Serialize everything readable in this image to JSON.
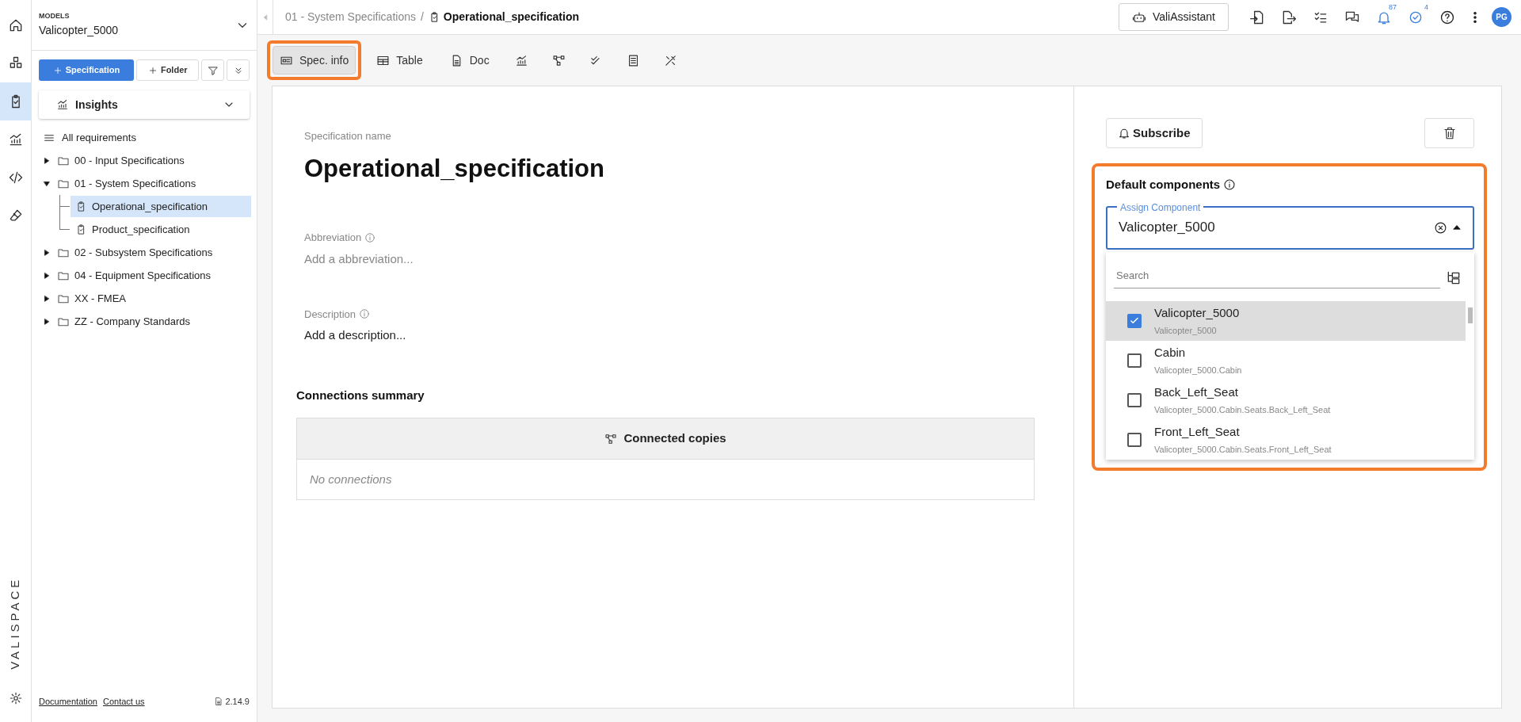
{
  "rail": {
    "items": [
      {
        "kind": "home",
        "selected": false
      },
      {
        "kind": "cubes",
        "selected": false
      },
      {
        "kind": "clipboard",
        "selected": true
      },
      {
        "kind": "chart",
        "selected": false
      },
      {
        "kind": "code",
        "selected": false
      },
      {
        "kind": "eraser",
        "selected": false
      }
    ],
    "logo": "VALISPACE"
  },
  "sidebar": {
    "model_label": "MODELS",
    "model_name": "Valicopter_5000",
    "new_spec_button": "Specification",
    "new_folder_button": "Folder",
    "insights": "Insights",
    "all_requirements": "All requirements",
    "tree": [
      {
        "label": "00 - Input Specifications",
        "kind": "folder",
        "expanded": false
      },
      {
        "label": "01 - System Specifications",
        "kind": "folder",
        "expanded": true,
        "children": [
          {
            "label": "Operational_specification",
            "selected": true
          },
          {
            "label": "Product_specification",
            "selected": false
          }
        ]
      },
      {
        "label": "02 - Subsystem Specifications",
        "kind": "folder",
        "expanded": false
      },
      {
        "label": "04 - Equipment Specifications",
        "kind": "folder",
        "expanded": false
      },
      {
        "label": "XX - FMEA",
        "kind": "folder",
        "expanded": false
      },
      {
        "label": "ZZ - Company Standards",
        "kind": "folder",
        "expanded": false
      }
    ],
    "footer": {
      "links": [
        "Documentation",
        "Contact us"
      ],
      "version": "2.14.9"
    }
  },
  "topbar": {
    "breadcrumb": {
      "parent": "01 - System Specifications",
      "separator": "/",
      "current": "Operational_specification"
    },
    "assistant_button": "ValiAssistant",
    "notifications_badge": "87",
    "tasks_badge": "4",
    "avatar": "PG"
  },
  "toolbar": {
    "tabs": [
      {
        "kind": "info",
        "label": "Spec. info",
        "selected": true,
        "annotated": true
      },
      {
        "kind": "table",
        "label": "Table",
        "selected": false,
        "annotated": false
      },
      {
        "kind": "doc",
        "label": "Doc",
        "selected": false,
        "annotated": false
      },
      {
        "kind": "chart",
        "selected": false,
        "annotated": false
      },
      {
        "kind": "graph",
        "selected": false,
        "annotated": false
      },
      {
        "kind": "checks",
        "selected": false,
        "annotated": false
      },
      {
        "kind": "list",
        "selected": false,
        "annotated": false
      },
      {
        "kind": "tools",
        "selected": false,
        "annotated": false
      }
    ]
  },
  "details": {
    "name_label": "Specification name",
    "name": "Operational_specification",
    "abbreviation_label": "Abbreviation",
    "abbreviation_placeholder": "Add a abbreviation...",
    "description_label": "Description",
    "description": "Add a description...",
    "connections_title": "Connections summary",
    "connections_header": "Connected copies",
    "connections_empty": "No connections"
  },
  "right_panel": {
    "subscribe_button": "Subscribe",
    "default_components": {
      "title": "Default components",
      "annotated": true,
      "field_label": "Assign Component",
      "field_value": "Valicopter_5000",
      "search_placeholder": "Search",
      "options": [
        {
          "name": "Valicopter_5000",
          "path": "Valicopter_5000",
          "checked": true,
          "selected": true
        },
        {
          "name": "Cabin",
          "path": "Valicopter_5000.Cabin",
          "checked": false,
          "selected": false
        },
        {
          "name": "Back_Left_Seat",
          "path": "Valicopter_5000.Cabin.Seats.Back_Left_Seat",
          "checked": false,
          "selected": false
        },
        {
          "name": "Front_Left_Seat",
          "path": "Valicopter_5000.Cabin.Seats.Front_Left_Seat",
          "checked": false,
          "selected": false
        }
      ]
    }
  }
}
